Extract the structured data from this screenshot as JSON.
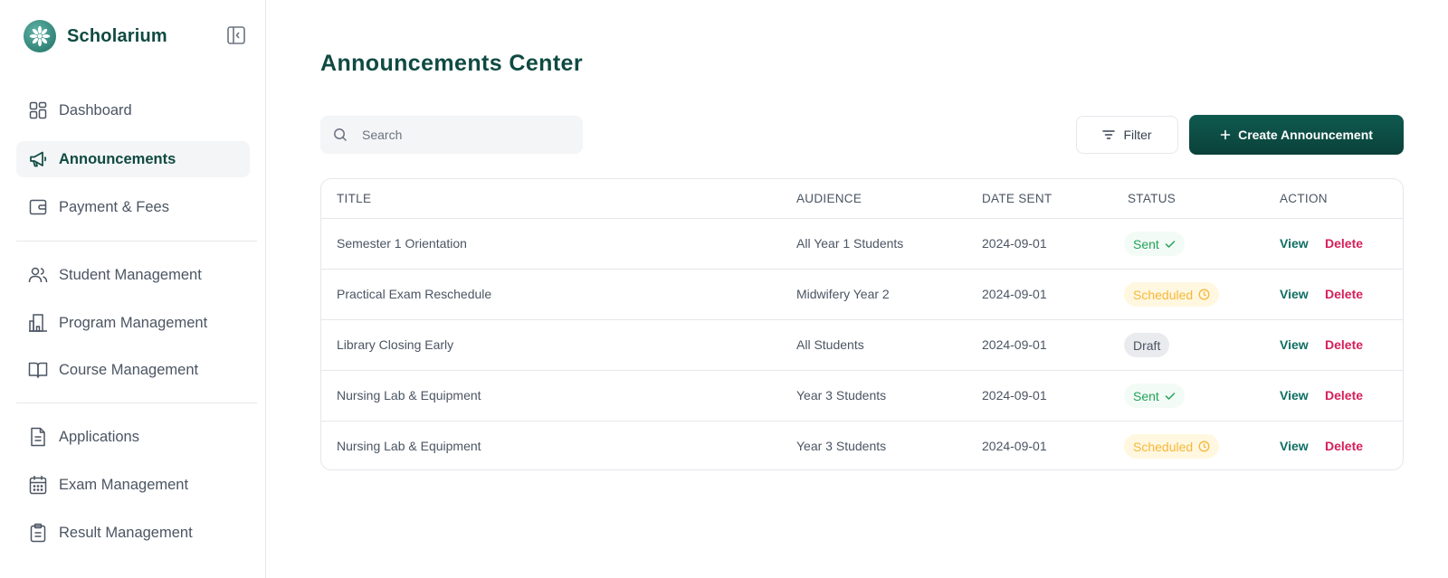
{
  "app": {
    "name": "Scholarium",
    "logo_icon": "flower-logo-icon",
    "collapse_icon": "sidebar-collapse-icon"
  },
  "sidebar": {
    "groups": [
      [
        {
          "label": "Dashboard",
          "icon": "dashboard-icon",
          "active": false
        },
        {
          "label": "Announcements",
          "icon": "megaphone-icon",
          "active": true
        },
        {
          "label": "Payment & Fees",
          "icon": "wallet-icon",
          "active": false
        }
      ],
      [
        {
          "label": "Student Management",
          "icon": "users-icon",
          "active": false
        },
        {
          "label": "Program Management",
          "icon": "building-icon",
          "active": false
        },
        {
          "label": "Course Management",
          "icon": "book-icon",
          "active": false
        }
      ],
      [
        {
          "label": "Applications",
          "icon": "document-icon",
          "active": false
        },
        {
          "label": "Exam Management",
          "icon": "calendar-icon",
          "active": false
        },
        {
          "label": "Result Management",
          "icon": "clipboard-icon",
          "active": false
        }
      ]
    ]
  },
  "main": {
    "title": "Announcements Center",
    "search": {
      "placeholder": "Search",
      "value": "",
      "icon": "search-icon"
    },
    "filter_button": {
      "label": "Filter",
      "icon": "filter-icon"
    },
    "create_button": {
      "label": "Create Announcement",
      "icon": "plus-icon"
    }
  },
  "table": {
    "columns": [
      "TITLE",
      "AUDIENCE",
      "DATE SENT",
      "STATUS",
      "ACTION"
    ],
    "rows": [
      {
        "title": "Semester 1 Orientation",
        "audience": "All Year 1 Students",
        "date": "2024-09-01",
        "status": "Sent",
        "status_type": "sent"
      },
      {
        "title": "Practical Exam Reschedule",
        "audience": "Midwifery Year 2",
        "date": "2024-09-01",
        "status": "Scheduled",
        "status_type": "scheduled"
      },
      {
        "title": "Library Closing Early",
        "audience": "All Students",
        "date": "2024-09-01",
        "status": "Draft",
        "status_type": "draft"
      },
      {
        "title": "Nursing Lab & Equipment",
        "audience": "Year 3 Students",
        "date": "2024-09-01",
        "status": "Sent",
        "status_type": "sent"
      },
      {
        "title": "Nursing Lab & Equipment",
        "audience": "Year 3 Students",
        "date": "2024-09-01",
        "status": "Scheduled",
        "status_type": "scheduled"
      }
    ],
    "actions": {
      "view": "View",
      "delete": "Delete"
    }
  },
  "colors": {
    "brand": "#0f4a42",
    "primary_button": "#0a4a41",
    "sent": "#22a35a",
    "scheduled": "#f5b83a",
    "delete": "#d61f5a",
    "view": "#0f6e62"
  }
}
